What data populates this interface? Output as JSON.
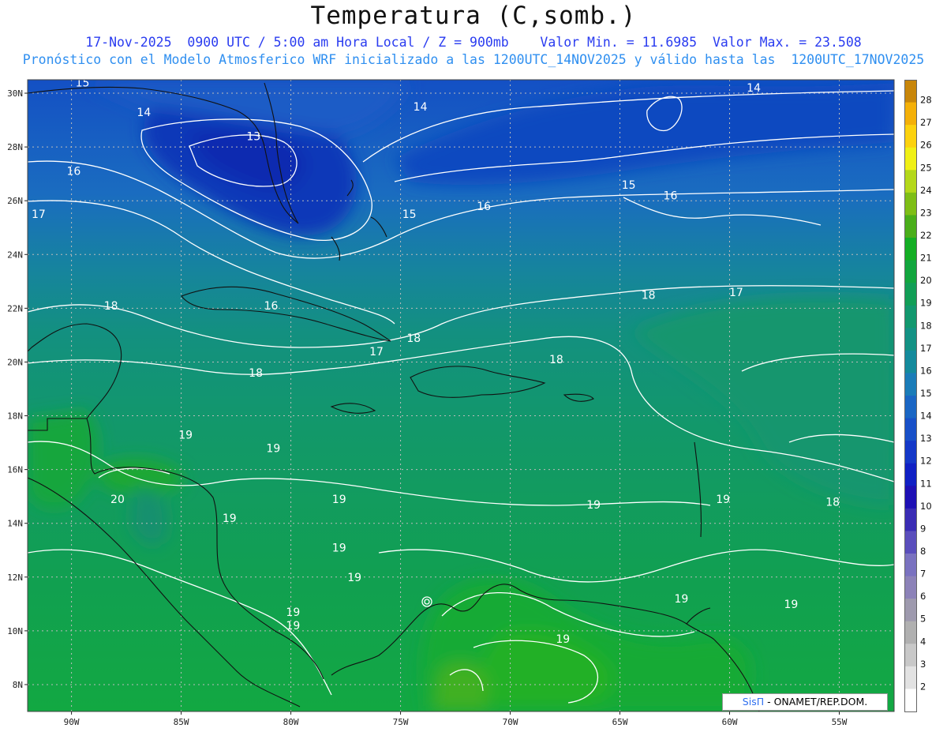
{
  "title": "Temperatura (C,somb.)",
  "subtitle_line1": "17-Nov-2025  0900 UTC / 5:00 am Hora Local / Z = 900mb    Valor Min. = 11.6985  Valor Max. = 23.508",
  "subtitle_line2": "Pronóstico con el Modelo Atmosferico WRF inicializado a las 1200UTC_14NOV2025 y válido hasta las  1200UTC_17NOV2025",
  "credit": {
    "brand": "SisΠ",
    "rest": " - ONAMET/REP.DOM."
  },
  "map_data": {
    "variable": "Temperatura",
    "units": "C",
    "level": "900mb",
    "valid": "17-Nov-2025 0900 UTC",
    "min": 11.6985,
    "max": 23.508,
    "lon_range": [
      -92,
      -52.5
    ],
    "lat_range": [
      7,
      30.5
    ],
    "lon_ticks": [
      {
        "value": -90,
        "label": "90W"
      },
      {
        "value": -85,
        "label": "85W"
      },
      {
        "value": -80,
        "label": "80W"
      },
      {
        "value": -75,
        "label": "75W"
      },
      {
        "value": -70,
        "label": "70W"
      },
      {
        "value": -65,
        "label": "65W"
      },
      {
        "value": -60,
        "label": "60W"
      },
      {
        "value": -55,
        "label": "55W"
      }
    ],
    "lat_ticks": [
      {
        "value": 30,
        "label": "30N"
      },
      {
        "value": 28,
        "label": "28N"
      },
      {
        "value": 26,
        "label": "26N"
      },
      {
        "value": 24,
        "label": "24N"
      },
      {
        "value": 22,
        "label": "22N"
      },
      {
        "value": 20,
        "label": "20N"
      },
      {
        "value": 18,
        "label": "18N"
      },
      {
        "value": 16,
        "label": "16N"
      },
      {
        "value": 14,
        "label": "14N"
      },
      {
        "value": 12,
        "label": "12N"
      },
      {
        "value": 10,
        "label": "10N"
      },
      {
        "value": 8,
        "label": "8N"
      }
    ],
    "contour_labels": [
      {
        "text": "15",
        "lon": -89.5,
        "lat": 30.4
      },
      {
        "text": "14",
        "lon": -86.7,
        "lat": 29.3
      },
      {
        "text": "14",
        "lon": -74.1,
        "lat": 29.5
      },
      {
        "text": "14",
        "lon": -58.9,
        "lat": 30.2
      },
      {
        "text": "13",
        "lon": -81.7,
        "lat": 28.4
      },
      {
        "text": "16",
        "lon": -89.9,
        "lat": 27.1
      },
      {
        "text": "15",
        "lon": -64.6,
        "lat": 26.6
      },
      {
        "text": "16",
        "lon": -62.7,
        "lat": 26.2
      },
      {
        "text": "16",
        "lon": -71.2,
        "lat": 25.8
      },
      {
        "text": "15",
        "lon": -74.6,
        "lat": 25.5
      },
      {
        "text": "17",
        "lon": -91.5,
        "lat": 25.5
      },
      {
        "text": "18",
        "lon": -63.7,
        "lat": 22.5
      },
      {
        "text": "17",
        "lon": -59.7,
        "lat": 22.6
      },
      {
        "text": "18",
        "lon": -88.2,
        "lat": 22.1
      },
      {
        "text": "16",
        "lon": -80.9,
        "lat": 22.1
      },
      {
        "text": "18",
        "lon": -74.4,
        "lat": 20.9
      },
      {
        "text": "17",
        "lon": -76.1,
        "lat": 20.4
      },
      {
        "text": "18",
        "lon": -67.9,
        "lat": 20.1
      },
      {
        "text": "18",
        "lon": -81.6,
        "lat": 19.6
      },
      {
        "text": "19",
        "lon": -84.8,
        "lat": 17.3
      },
      {
        "text": "19",
        "lon": -80.8,
        "lat": 16.8
      },
      {
        "text": "20",
        "lon": -87.9,
        "lat": 14.9
      },
      {
        "text": "19",
        "lon": -77.8,
        "lat": 14.9
      },
      {
        "text": "19",
        "lon": -66.2,
        "lat": 14.7
      },
      {
        "text": "19",
        "lon": -60.3,
        "lat": 14.9
      },
      {
        "text": "18",
        "lon": -55.3,
        "lat": 14.8
      },
      {
        "text": "19",
        "lon": -82.8,
        "lat": 14.2
      },
      {
        "text": "19",
        "lon": -77.8,
        "lat": 13.1
      },
      {
        "text": "19",
        "lon": -77.1,
        "lat": 12.0
      },
      {
        "text": "19",
        "lon": -62.2,
        "lat": 11.2
      },
      {
        "text": "19",
        "lon": -57.2,
        "lat": 11.0
      },
      {
        "text": "19",
        "lon": -79.9,
        "lat": 10.7
      },
      {
        "text": "19",
        "lon": -79.9,
        "lat": 10.2
      },
      {
        "text": "19",
        "lon": -67.6,
        "lat": 9.7
      }
    ]
  },
  "colorbar": {
    "levels": [
      {
        "label": "",
        "color": "#ffffff"
      },
      {
        "label": "2",
        "color": "#e2e2e2"
      },
      {
        "label": "3",
        "color": "#c8c8c8"
      },
      {
        "label": "4",
        "color": "#b0b0b0"
      },
      {
        "label": "5",
        "color": "#9e9aae"
      },
      {
        "label": "6",
        "color": "#8c82b8"
      },
      {
        "label": "7",
        "color": "#7a72c0"
      },
      {
        "label": "8",
        "color": "#5a4ebc"
      },
      {
        "label": "9",
        "color": "#3a2cb4"
      },
      {
        "label": "10",
        "color": "#1e10b4"
      },
      {
        "label": "11",
        "color": "#1020c4"
      },
      {
        "label": "12",
        "color": "#1438c8"
      },
      {
        "label": "13",
        "color": "#1850c8"
      },
      {
        "label": "14",
        "color": "#1a66c4"
      },
      {
        "label": "15",
        "color": "#1a7cb8"
      },
      {
        "label": "16",
        "color": "#148a9c"
      },
      {
        "label": "17",
        "color": "#139284"
      },
      {
        "label": "18",
        "color": "#12986e"
      },
      {
        "label": "19",
        "color": "#119e56"
      },
      {
        "label": "20",
        "color": "#12a63e"
      },
      {
        "label": "21",
        "color": "#14ae24"
      },
      {
        "label": "22",
        "color": "#4aae1a"
      },
      {
        "label": "23",
        "color": "#7ebe16"
      },
      {
        "label": "24",
        "color": "#b4d81a"
      },
      {
        "label": "25",
        "color": "#f0f016"
      },
      {
        "label": "26",
        "color": "#fcd20e"
      },
      {
        "label": "27",
        "color": "#f4b008"
      },
      {
        "label": "28",
        "color": "#c8860a"
      }
    ]
  }
}
